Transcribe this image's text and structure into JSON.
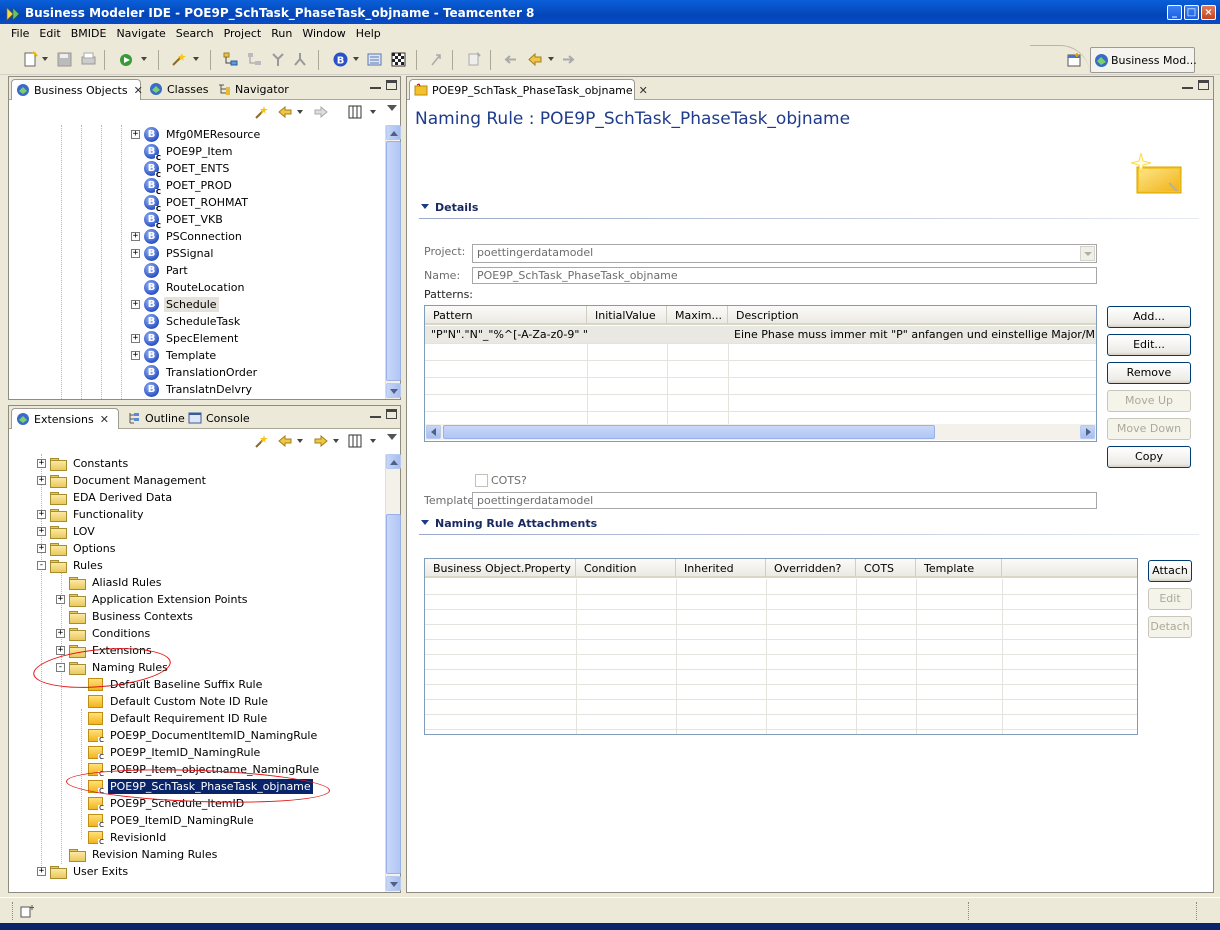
{
  "window": {
    "title": "Business Modeler IDE - POE9P_SchTask_PhaseTask_objname - Teamcenter 8"
  },
  "menu": [
    "File",
    "Edit",
    "BMIDE",
    "Navigate",
    "Search",
    "Project",
    "Run",
    "Window",
    "Help"
  ],
  "perspective": {
    "label": "Business Mod..."
  },
  "top_left_pane": {
    "tabs": [
      "Business Objects",
      "Classes",
      "Navigator"
    ],
    "tree": [
      {
        "label": "Mfg0MEResource",
        "expander": "+",
        "sub": ""
      },
      {
        "label": "POE9P_Item",
        "expander": "",
        "sub": "C"
      },
      {
        "label": "POET_ENTS",
        "expander": "",
        "sub": "C"
      },
      {
        "label": "POET_PROD",
        "expander": "",
        "sub": "C"
      },
      {
        "label": "POET_ROHMAT",
        "expander": "",
        "sub": "C"
      },
      {
        "label": "POET_VKB",
        "expander": "",
        "sub": "C"
      },
      {
        "label": "PSConnection",
        "expander": "+",
        "sub": ""
      },
      {
        "label": "PSSignal",
        "expander": "+",
        "sub": ""
      },
      {
        "label": "Part",
        "expander": "",
        "sub": ""
      },
      {
        "label": "RouteLocation",
        "expander": "",
        "sub": ""
      },
      {
        "label": "Schedule",
        "expander": "+",
        "sub": "",
        "highlight": true
      },
      {
        "label": "ScheduleTask",
        "expander": "",
        "sub": ""
      },
      {
        "label": "SpecElement",
        "expander": "+",
        "sub": ""
      },
      {
        "label": "Template",
        "expander": "+",
        "sub": ""
      },
      {
        "label": "TranslationOrder",
        "expander": "",
        "sub": ""
      },
      {
        "label": "TranslatnDelvry",
        "expander": "",
        "sub": ""
      }
    ]
  },
  "bottom_left_pane": {
    "tabs": [
      "Extensions",
      "Outline",
      "Console"
    ],
    "tree": [
      {
        "label": "Constants",
        "level": 0,
        "expander": "+",
        "icon": "folder"
      },
      {
        "label": "Document Management",
        "level": 0,
        "expander": "+",
        "icon": "folder"
      },
      {
        "label": "EDA Derived Data",
        "level": 0,
        "expander": "",
        "icon": "folder"
      },
      {
        "label": "Functionality",
        "level": 0,
        "expander": "+",
        "icon": "folder"
      },
      {
        "label": "LOV",
        "level": 0,
        "expander": "+",
        "icon": "folder"
      },
      {
        "label": "Options",
        "level": 0,
        "expander": "+",
        "icon": "folder"
      },
      {
        "label": "Rules",
        "level": 0,
        "expander": "-",
        "icon": "folder"
      },
      {
        "label": "AliasId Rules",
        "level": 1,
        "expander": "",
        "icon": "folder"
      },
      {
        "label": "Application Extension Points",
        "level": 1,
        "expander": "+",
        "icon": "folder"
      },
      {
        "label": "Business Contexts",
        "level": 1,
        "expander": "",
        "icon": "folder"
      },
      {
        "label": "Conditions",
        "level": 1,
        "expander": "+",
        "icon": "folder"
      },
      {
        "label": "Extensions",
        "level": 1,
        "expander": "+",
        "icon": "folder"
      },
      {
        "label": "Naming Rules",
        "level": 1,
        "expander": "-",
        "icon": "folder"
      },
      {
        "label": "Default Baseline Suffix Rule",
        "level": 2,
        "expander": "",
        "icon": "rule",
        "sub": ""
      },
      {
        "label": "Default Custom Note ID Rule",
        "level": 2,
        "expander": "",
        "icon": "rule",
        "sub": ""
      },
      {
        "label": "Default Requirement ID Rule",
        "level": 2,
        "expander": "",
        "icon": "rule",
        "sub": ""
      },
      {
        "label": "POE9P_DocumentItemID_NamingRule",
        "level": 2,
        "expander": "",
        "icon": "rule",
        "sub": "C"
      },
      {
        "label": "POE9P_ItemID_NamingRule",
        "level": 2,
        "expander": "",
        "icon": "rule",
        "sub": "C"
      },
      {
        "label": "POE9P_Item_objectname_NamingRule",
        "level": 2,
        "expander": "",
        "icon": "rule",
        "sub": "C"
      },
      {
        "label": "POE9P_SchTask_PhaseTask_objname",
        "level": 2,
        "expander": "",
        "icon": "rule",
        "sub": "C",
        "selected": true
      },
      {
        "label": "POE9P_Schedule_ItemID",
        "level": 2,
        "expander": "",
        "icon": "rule",
        "sub": "C"
      },
      {
        "label": "POE9_ItemID_NamingRule",
        "level": 2,
        "expander": "",
        "icon": "rule",
        "sub": "C"
      },
      {
        "label": "RevisionId",
        "level": 2,
        "expander": "",
        "icon": "rule",
        "sub": "C"
      },
      {
        "label": "Revision Naming Rules",
        "level": 1,
        "expander": "",
        "icon": "folder"
      },
      {
        "label": "User Exits",
        "level": 0,
        "expander": "+",
        "icon": "folder"
      }
    ]
  },
  "editor": {
    "tab": "POE9P_SchTask_PhaseTask_objname",
    "title": "Naming Rule : POE9P_SchTask_PhaseTask_objname",
    "details_section": "Details",
    "project_label": "Project:",
    "project_value": "poettingerdatamodel",
    "name_label": "Name:",
    "name_value": "POE9P_SchTask_PhaseTask_objname",
    "patterns_label": "Patterns:",
    "patterns_columns": [
      "Pattern",
      "InitialValue",
      "Maxim...",
      "Description"
    ],
    "patterns_rows": [
      [
        "\"P\"N\".\"N\"_\"%^[-A-Za-z0-9\" \"...",
        "",
        "",
        "Eine Phase muss immer mit \"P\" anfangen und einstellige Major/Minor Version"
      ]
    ],
    "pattern_buttons": [
      "Add...",
      "Edit...",
      "Remove",
      "Move Up",
      "Move Down",
      "Copy"
    ],
    "cots_label": "COTS?",
    "template_label": "Template",
    "template_value": "poettingerdatamodel",
    "attachments_section": "Naming Rule Attachments",
    "attachment_columns": [
      "Business Object.Property",
      "Condition",
      "Inherited",
      "Overridden?",
      "COTS",
      "Template"
    ],
    "attachment_buttons": [
      "Attach",
      "Edit",
      "Detach"
    ]
  }
}
